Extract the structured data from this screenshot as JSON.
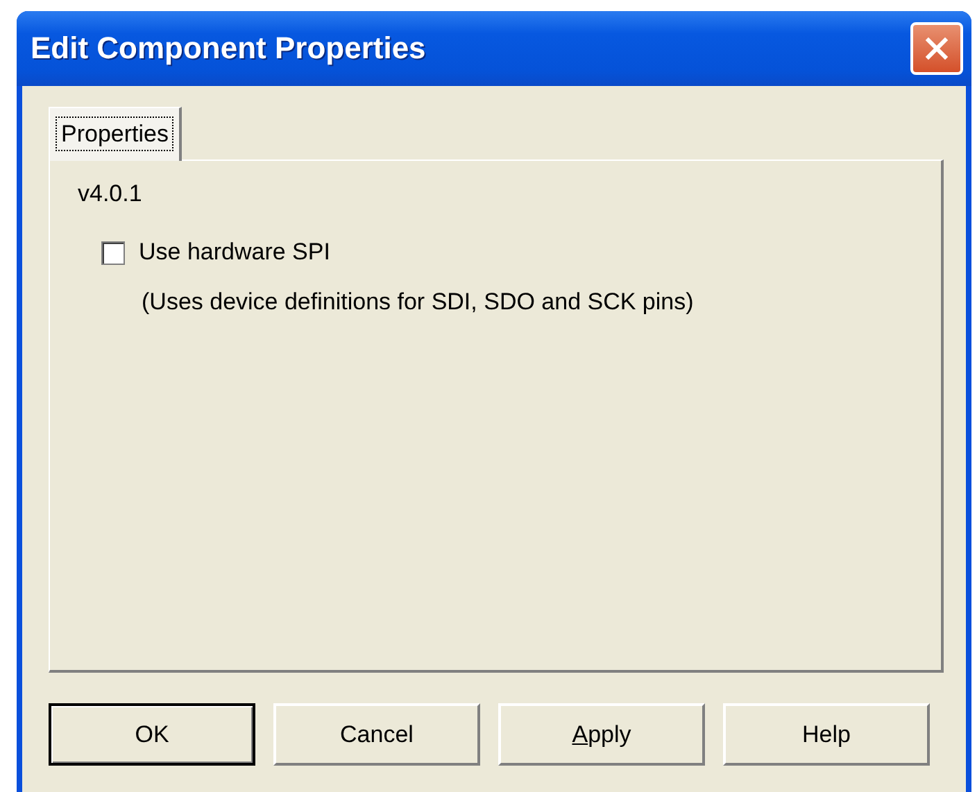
{
  "window": {
    "title": "Edit Component Properties"
  },
  "tabs": [
    {
      "label": "Properties",
      "selected": true
    }
  ],
  "version": "v4.0.1",
  "options": [
    {
      "label": "Use hardware SPI",
      "checked": false,
      "note": "(Uses device definitions for SDI, SDO and SCK pins)"
    }
  ],
  "buttons": [
    {
      "label": "OK",
      "default": true
    },
    {
      "label": "Cancel",
      "default": false
    },
    {
      "label": "Apply",
      "default": false,
      "mnemonic": true
    },
    {
      "label": "Help",
      "default": false
    }
  ]
}
